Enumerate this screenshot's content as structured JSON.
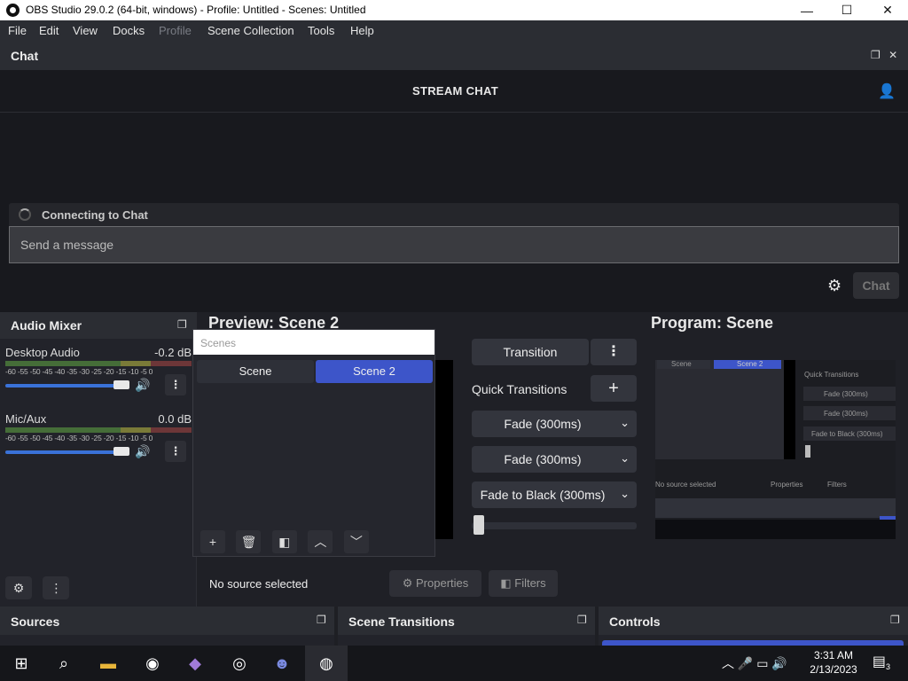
{
  "window": {
    "title": "OBS Studio 29.0.2 (64-bit, windows) - Profile: Untitled - Scenes: Untitled",
    "controls": {
      "minimize": "—",
      "maximize": "☐",
      "close": "✕"
    }
  },
  "menu": {
    "items": [
      "File",
      "Edit",
      "View",
      "Docks",
      "Profile",
      "Scene Collection",
      "Tools",
      "Help"
    ]
  },
  "chat": {
    "dock_title": "Chat",
    "header": "STREAM CHAT",
    "status": "Connecting to Chat",
    "input_placeholder": "Send a message",
    "send_label": "Chat"
  },
  "audio_mixer": {
    "title": "Audio Mixer",
    "ticks": "-60 -55 -50 -45 -40 -35 -30 -25 -20 -15 -10 -5  0",
    "channels": [
      {
        "name": "Desktop Audio",
        "db": "-0.2 dB",
        "volume": 0.92
      },
      {
        "name": "Mic/Aux",
        "db": "0.0 dB",
        "volume": 0.92
      }
    ]
  },
  "preview": {
    "title": "Preview: Scene 2"
  },
  "program": {
    "title": "Program: Scene",
    "thumb": {
      "scene": "Scene",
      "scene2": "Scene 2",
      "quick_transitions": "Quick Transitions",
      "fade1": "Fade (300ms)",
      "fade2": "Fade (300ms)",
      "fade_black": "Fade to Black (300ms)",
      "no_source": "No source selected",
      "properties": "Properties",
      "filters": "Filters"
    }
  },
  "scenes": {
    "dock_title": "Scenes",
    "items": [
      {
        "label": "Scene",
        "active": false
      },
      {
        "label": "Scene 2",
        "active": true
      }
    ]
  },
  "transitions": {
    "transition_label": "Transition",
    "quick_label": "Quick Transitions",
    "options": [
      "Fade (300ms)",
      "Fade (300ms)",
      "Fade to Black (300ms)"
    ],
    "tbar_value": 0
  },
  "source_bar": {
    "status": "No source selected",
    "properties": "Properties",
    "filters": "Filters"
  },
  "bottom_docks": {
    "sources": "Sources",
    "scene_transitions": "Scene Transitions",
    "controls": "Controls"
  },
  "taskbar": {
    "time": "3:31 AM",
    "date": "2/13/2023",
    "notification_count": "3"
  },
  "colors": {
    "accent": "#3d55c9",
    "panel": "#22232a",
    "header": "#2b2d33"
  }
}
